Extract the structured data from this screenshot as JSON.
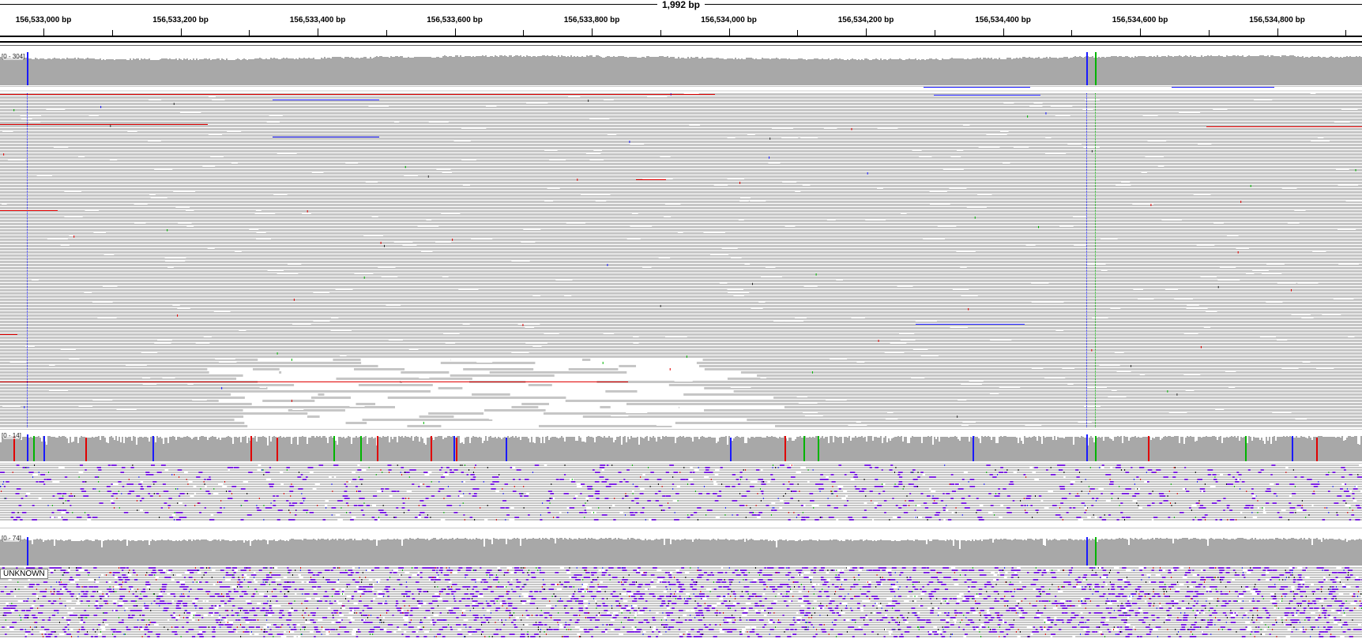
{
  "ruler": {
    "span_label": "1,992 bp",
    "ticks": [
      "156,533,000 bp",
      "156,533,200 bp",
      "156,533,400 bp",
      "156,533,600 bp",
      "156,533,800 bp",
      "156,534,000 bp",
      "156,534,200 bp",
      "156,534,400 bp",
      "156,534,600 bp",
      "156,534,800 bp"
    ]
  },
  "tracks": {
    "coverage1_range": "[0 - 304]",
    "coverage2_range": "[0 - 14]",
    "coverage3_range": "[0 - 74]",
    "group_label": "UNKNOWN"
  },
  "colors": {
    "coverage_gray": "#a8a8a8",
    "read_gray": "#c6c6c6",
    "mismatch_blue": "#1a1aff",
    "mismatch_green": "#00b400",
    "mismatch_red": "#e00000",
    "insertion_purple": "#7a1fe0",
    "deletion_line": "#000000"
  }
}
